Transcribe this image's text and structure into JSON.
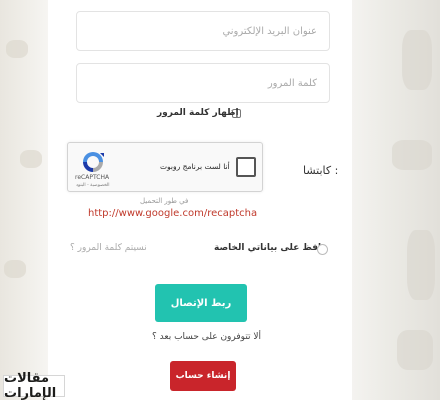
{
  "login_form": {
    "email_placeholder": "عنوان البريد الإلكتروني",
    "password_placeholder": "كلمة المرور",
    "show_password_label": "إظهار كلمة المرور",
    "captcha_label": "كابتشا :",
    "recaptcha": {
      "checkbox_label": "أنا لست برنامج روبوت",
      "brand": "reCAPTCHA",
      "links": "الخصوصية - البنود"
    },
    "dev_note": "في طور التحميل",
    "captcha_url": "http://www.google.com/recaptcha",
    "remember_me_label": "حافظ على بياناتي الخاصة",
    "forgot_password": "نسيتم كلمة المرور ؟",
    "login_button": "ربط الإتصال",
    "no_account_text": "ألا تتوفرون على حساب بعد ؟",
    "register_button": "إنشاء حساب"
  },
  "watermark": {
    "text": "مقالات الإمارات"
  },
  "colors": {
    "login_button": "#22c3b0",
    "register_button": "#c9252b",
    "captcha_url": "#c0392b"
  }
}
